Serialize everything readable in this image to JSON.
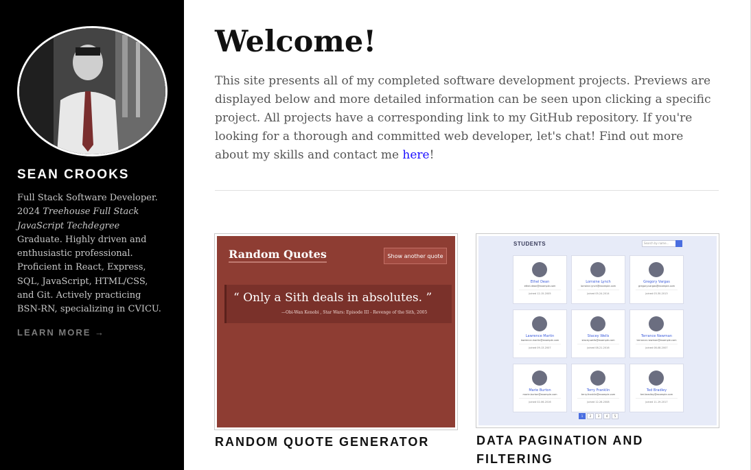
{
  "sidebar": {
    "name": "SEAN CROOKS",
    "bio_part1": "Full Stack Software Developer. 2024 ",
    "bio_italic": "Treehouse Full Stack JavaScript Techdegree",
    "bio_part2": " Graduate. Highly driven and enthusiastic professional. Proficient in React, Express, SQL, JavaScript, HTML/CSS, and Git. Actively practicing BSN-RN, specializing in CVICU.",
    "learn_more": "LEARN MORE →"
  },
  "main": {
    "title": "Welcome!",
    "intro": "This site presents all of my completed software development projects. Previews are displayed below and more detailed information can be seen upon clicking a specific project. All projects have a corresponding link to my GitHub repository. If you're looking for a thorough and committed web developer, let's chat! Find out more about my skills and contact me ",
    "intro_link": "here",
    "intro_end": "!"
  },
  "projects": [
    {
      "title": "RANDOM QUOTE GENERATOR",
      "preview": {
        "heading": "Random Quotes",
        "button": "Show another quote",
        "quote": "“ Only a Sith deals in absolutes. ”",
        "citation": "—Obi-Wan Kenobi , Star Wars: Episode III - Revenge of the Sith, 2005",
        "bg_color": "#8e3d33"
      }
    },
    {
      "title": "DATA PAGINATION AND FILTERING",
      "preview": {
        "heading": "STUDENTS",
        "search_placeholder": "Search by name...",
        "students": [
          {
            "name": "Ethel Dean",
            "email": "ethel.dean@example.com",
            "joined": "Joined 12-15-2005"
          },
          {
            "name": "Lorraine Lynch",
            "email": "lorraine.lynch@example.com",
            "joined": "Joined 05-24-2014"
          },
          {
            "name": "Gregory Vargas",
            "email": "gregory.vargas@example.com",
            "joined": "Joined 03-30-2013"
          },
          {
            "name": "Lawrence Martin",
            "email": "lawrence.martin@example.com",
            "joined": "Joined 09-13-2007"
          },
          {
            "name": "Stacey Wells",
            "email": "stacey.wells@example.com",
            "joined": "Joined 08-21-2016"
          },
          {
            "name": "Terrance Newman",
            "email": "terrance.newman@example.com",
            "joined": "Joined 08-08-2007"
          },
          {
            "name": "Marie Burton",
            "email": "marie.burton@example.com",
            "joined": "Joined 02-06-2016"
          },
          {
            "name": "Terry Franklin",
            "email": "terry.franklin@example.com",
            "joined": "Joined 12-26-2008"
          },
          {
            "name": "Ted Bradley",
            "email": "ted.bradley@example.com",
            "joined": "Joined 11-19-2017"
          }
        ],
        "pages": [
          "1",
          "2",
          "3",
          "4",
          "5"
        ],
        "bg_color": "#e7ebf8"
      }
    }
  ]
}
